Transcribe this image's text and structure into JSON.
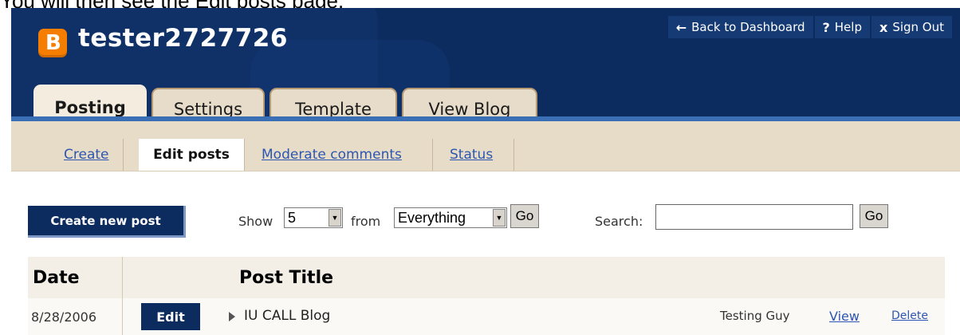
{
  "caption": "You will then see the Edit posts page.",
  "header": {
    "blog_name": "tester2727726",
    "logo_letter": "B",
    "brand_color": "#f57d00",
    "links": [
      {
        "icon": "back-arrow-icon",
        "glyph": "←",
        "label": "Back to Dashboard"
      },
      {
        "icon": "help-icon",
        "glyph": "?",
        "label": "Help"
      },
      {
        "icon": "close-icon",
        "glyph": "x",
        "label": "Sign Out"
      }
    ]
  },
  "tabs": [
    {
      "label": "Posting",
      "active": true
    },
    {
      "label": "Settings",
      "active": false
    },
    {
      "label": "Template",
      "active": false
    },
    {
      "label": "View Blog",
      "active": false
    }
  ],
  "subnav": [
    {
      "label": "Create",
      "active": false
    },
    {
      "label": "Edit posts",
      "active": true
    },
    {
      "label": "Moderate comments",
      "active": false
    },
    {
      "label": "Status",
      "active": false
    }
  ],
  "toolbar": {
    "create_label": "Create new post",
    "show_label": "Show",
    "show_value": "5",
    "from_label": "from",
    "from_value": "Everything",
    "go_label": "Go",
    "search_label": "Search:",
    "search_value": "",
    "search_go_label": "Go"
  },
  "table": {
    "headers": {
      "date": "Date",
      "title": "Post Title"
    },
    "rows": [
      {
        "date": "8/28/2006",
        "edit": "Edit",
        "title": "IU CALL Blog",
        "author": "Testing Guy",
        "view": "View",
        "delete": "Delete"
      }
    ]
  }
}
